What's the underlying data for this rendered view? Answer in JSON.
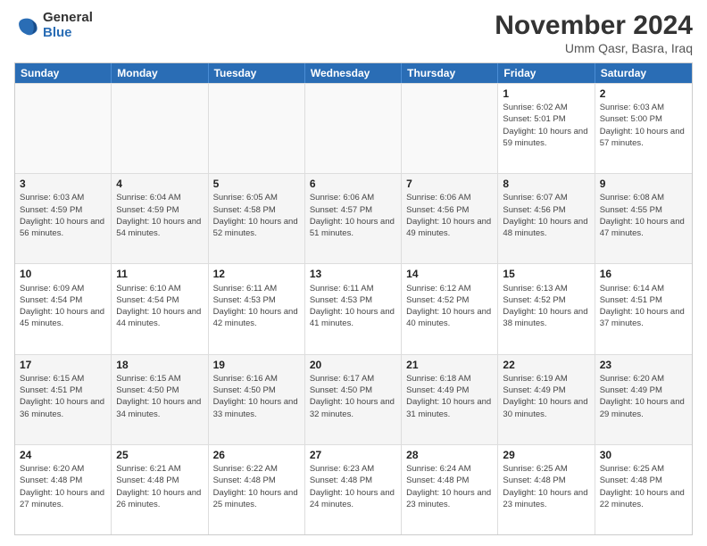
{
  "logo": {
    "general": "General",
    "blue": "Blue"
  },
  "title": "November 2024",
  "location": "Umm Qasr, Basra, Iraq",
  "days_of_week": [
    "Sunday",
    "Monday",
    "Tuesday",
    "Wednesday",
    "Thursday",
    "Friday",
    "Saturday"
  ],
  "weeks": [
    [
      {
        "day": "",
        "info": ""
      },
      {
        "day": "",
        "info": ""
      },
      {
        "day": "",
        "info": ""
      },
      {
        "day": "",
        "info": ""
      },
      {
        "day": "",
        "info": ""
      },
      {
        "day": "1",
        "info": "Sunrise: 6:02 AM\nSunset: 5:01 PM\nDaylight: 10 hours and 59 minutes."
      },
      {
        "day": "2",
        "info": "Sunrise: 6:03 AM\nSunset: 5:00 PM\nDaylight: 10 hours and 57 minutes."
      }
    ],
    [
      {
        "day": "3",
        "info": "Sunrise: 6:03 AM\nSunset: 4:59 PM\nDaylight: 10 hours and 56 minutes."
      },
      {
        "day": "4",
        "info": "Sunrise: 6:04 AM\nSunset: 4:59 PM\nDaylight: 10 hours and 54 minutes."
      },
      {
        "day": "5",
        "info": "Sunrise: 6:05 AM\nSunset: 4:58 PM\nDaylight: 10 hours and 52 minutes."
      },
      {
        "day": "6",
        "info": "Sunrise: 6:06 AM\nSunset: 4:57 PM\nDaylight: 10 hours and 51 minutes."
      },
      {
        "day": "7",
        "info": "Sunrise: 6:06 AM\nSunset: 4:56 PM\nDaylight: 10 hours and 49 minutes."
      },
      {
        "day": "8",
        "info": "Sunrise: 6:07 AM\nSunset: 4:56 PM\nDaylight: 10 hours and 48 minutes."
      },
      {
        "day": "9",
        "info": "Sunrise: 6:08 AM\nSunset: 4:55 PM\nDaylight: 10 hours and 47 minutes."
      }
    ],
    [
      {
        "day": "10",
        "info": "Sunrise: 6:09 AM\nSunset: 4:54 PM\nDaylight: 10 hours and 45 minutes."
      },
      {
        "day": "11",
        "info": "Sunrise: 6:10 AM\nSunset: 4:54 PM\nDaylight: 10 hours and 44 minutes."
      },
      {
        "day": "12",
        "info": "Sunrise: 6:11 AM\nSunset: 4:53 PM\nDaylight: 10 hours and 42 minutes."
      },
      {
        "day": "13",
        "info": "Sunrise: 6:11 AM\nSunset: 4:53 PM\nDaylight: 10 hours and 41 minutes."
      },
      {
        "day": "14",
        "info": "Sunrise: 6:12 AM\nSunset: 4:52 PM\nDaylight: 10 hours and 40 minutes."
      },
      {
        "day": "15",
        "info": "Sunrise: 6:13 AM\nSunset: 4:52 PM\nDaylight: 10 hours and 38 minutes."
      },
      {
        "day": "16",
        "info": "Sunrise: 6:14 AM\nSunset: 4:51 PM\nDaylight: 10 hours and 37 minutes."
      }
    ],
    [
      {
        "day": "17",
        "info": "Sunrise: 6:15 AM\nSunset: 4:51 PM\nDaylight: 10 hours and 36 minutes."
      },
      {
        "day": "18",
        "info": "Sunrise: 6:15 AM\nSunset: 4:50 PM\nDaylight: 10 hours and 34 minutes."
      },
      {
        "day": "19",
        "info": "Sunrise: 6:16 AM\nSunset: 4:50 PM\nDaylight: 10 hours and 33 minutes."
      },
      {
        "day": "20",
        "info": "Sunrise: 6:17 AM\nSunset: 4:50 PM\nDaylight: 10 hours and 32 minutes."
      },
      {
        "day": "21",
        "info": "Sunrise: 6:18 AM\nSunset: 4:49 PM\nDaylight: 10 hours and 31 minutes."
      },
      {
        "day": "22",
        "info": "Sunrise: 6:19 AM\nSunset: 4:49 PM\nDaylight: 10 hours and 30 minutes."
      },
      {
        "day": "23",
        "info": "Sunrise: 6:20 AM\nSunset: 4:49 PM\nDaylight: 10 hours and 29 minutes."
      }
    ],
    [
      {
        "day": "24",
        "info": "Sunrise: 6:20 AM\nSunset: 4:48 PM\nDaylight: 10 hours and 27 minutes."
      },
      {
        "day": "25",
        "info": "Sunrise: 6:21 AM\nSunset: 4:48 PM\nDaylight: 10 hours and 26 minutes."
      },
      {
        "day": "26",
        "info": "Sunrise: 6:22 AM\nSunset: 4:48 PM\nDaylight: 10 hours and 25 minutes."
      },
      {
        "day": "27",
        "info": "Sunrise: 6:23 AM\nSunset: 4:48 PM\nDaylight: 10 hours and 24 minutes."
      },
      {
        "day": "28",
        "info": "Sunrise: 6:24 AM\nSunset: 4:48 PM\nDaylight: 10 hours and 23 minutes."
      },
      {
        "day": "29",
        "info": "Sunrise: 6:25 AM\nSunset: 4:48 PM\nDaylight: 10 hours and 23 minutes."
      },
      {
        "day": "30",
        "info": "Sunrise: 6:25 AM\nSunset: 4:48 PM\nDaylight: 10 hours and 22 minutes."
      }
    ]
  ]
}
